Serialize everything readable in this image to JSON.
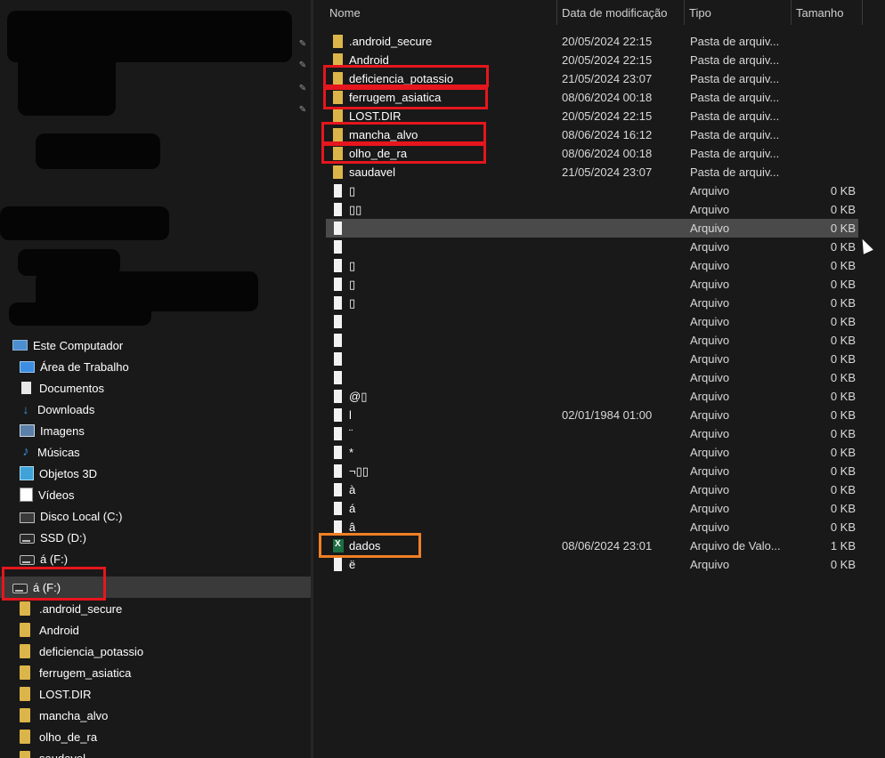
{
  "columns": {
    "name": "Nome",
    "modified": "Data de modificação",
    "type": "Tipo",
    "size": "Tamanho"
  },
  "files": [
    {
      "name": ".android_secure",
      "date": "20/05/2024 22:15",
      "type": "Pasta de arquiv...",
      "size": "",
      "kind": "folder"
    },
    {
      "name": "Android",
      "date": "20/05/2024 22:15",
      "type": "Pasta de arquiv...",
      "size": "",
      "kind": "folder"
    },
    {
      "name": "deficiencia_potassio",
      "date": "21/05/2024 23:07",
      "type": "Pasta de arquiv...",
      "size": "",
      "kind": "folder"
    },
    {
      "name": "ferrugem_asiatica",
      "date": "08/06/2024 00:18",
      "type": "Pasta de arquiv...",
      "size": "",
      "kind": "folder"
    },
    {
      "name": "LOST.DIR",
      "date": "20/05/2024 22:15",
      "type": "Pasta de arquiv...",
      "size": "",
      "kind": "folder"
    },
    {
      "name": "mancha_alvo",
      "date": "08/06/2024 16:12",
      "type": "Pasta de arquiv...",
      "size": "",
      "kind": "folder"
    },
    {
      "name": "olho_de_ra",
      "date": "08/06/2024 00:18",
      "type": "Pasta de arquiv...",
      "size": "",
      "kind": "folder"
    },
    {
      "name": "saudavel",
      "date": "21/05/2024 23:07",
      "type": "Pasta de arquiv...",
      "size": "",
      "kind": "folder"
    },
    {
      "name": "▯",
      "date": "",
      "type": "Arquivo",
      "size": "0 KB",
      "kind": "file"
    },
    {
      "name": "▯▯",
      "date": "",
      "type": "Arquivo",
      "size": "0 KB",
      "kind": "file"
    },
    {
      "name": "",
      "date": "",
      "type": "Arquivo",
      "size": "0 KB",
      "kind": "file"
    },
    {
      "name": "",
      "date": "",
      "type": "Arquivo",
      "size": "0 KB",
      "kind": "file"
    },
    {
      "name": "▯",
      "date": "",
      "type": "Arquivo",
      "size": "0 KB",
      "kind": "file"
    },
    {
      "name": "▯",
      "date": "",
      "type": "Arquivo",
      "size": "0 KB",
      "kind": "file"
    },
    {
      "name": "▯",
      "date": "",
      "type": "Arquivo",
      "size": "0 KB",
      "kind": "file"
    },
    {
      "name": "",
      "date": "",
      "type": "Arquivo",
      "size": "0 KB",
      "kind": "file"
    },
    {
      "name": "",
      "date": "",
      "type": "Arquivo",
      "size": "0 KB",
      "kind": "file"
    },
    {
      "name": "",
      "date": "",
      "type": "Arquivo",
      "size": "0 KB",
      "kind": "file"
    },
    {
      "name": "",
      "date": "",
      "type": "Arquivo",
      "size": "0 KB",
      "kind": "file"
    },
    {
      "name": " @▯",
      "date": "",
      "type": "Arquivo",
      "size": "0 KB",
      "kind": "file"
    },
    {
      "name": "l",
      "date": "02/01/1984 01:00",
      "type": "Arquivo",
      "size": "0 KB",
      "kind": "file"
    },
    {
      "name": "¨",
      "date": "",
      "type": "Arquivo",
      "size": "0 KB",
      "kind": "file"
    },
    {
      "name": "*",
      "date": "",
      "type": "Arquivo",
      "size": "0 KB",
      "kind": "file"
    },
    {
      "name": "¬▯▯",
      "date": "",
      "type": "Arquivo",
      "size": "0 KB",
      "kind": "file"
    },
    {
      "name": "à",
      "date": "",
      "type": "Arquivo",
      "size": "0 KB",
      "kind": "file"
    },
    {
      "name": "á",
      "date": "",
      "type": "Arquivo",
      "size": "0 KB",
      "kind": "file"
    },
    {
      "name": "â",
      "date": "",
      "type": "Arquivo",
      "size": "0 KB",
      "kind": "file"
    },
    {
      "name": "dados",
      "date": "08/06/2024 23:01",
      "type": "Arquivo de Valo...",
      "size": "1 KB",
      "kind": "csv"
    },
    {
      "name": "ë",
      "date": "",
      "type": "Arquivo",
      "size": "0 KB",
      "kind": "file"
    }
  ],
  "sidebar": {
    "this_pc": "Este Computador",
    "desktop": "Área de Trabalho",
    "documents": "Documentos",
    "downloads": "Downloads",
    "images": "Imagens",
    "music": "Músicas",
    "objects3d": "Objetos 3D",
    "videos": "Vídeos",
    "local_disk": "Disco Local (C:)",
    "ssd": "SSD (D:)",
    "drive_f": "á (F:)",
    "drive_f_selected": "á (F:)",
    "tree": [
      ".android_secure",
      "Android",
      "deficiencia_potassio",
      "ferrugem_asiatica",
      "LOST.DIR",
      "mancha_alvo",
      "olho_de_ra",
      "saudavel"
    ]
  },
  "colors": {
    "annotation_red": "#e5161d",
    "annotation_orange": "#f07f24",
    "folder": "#dcb54a"
  }
}
